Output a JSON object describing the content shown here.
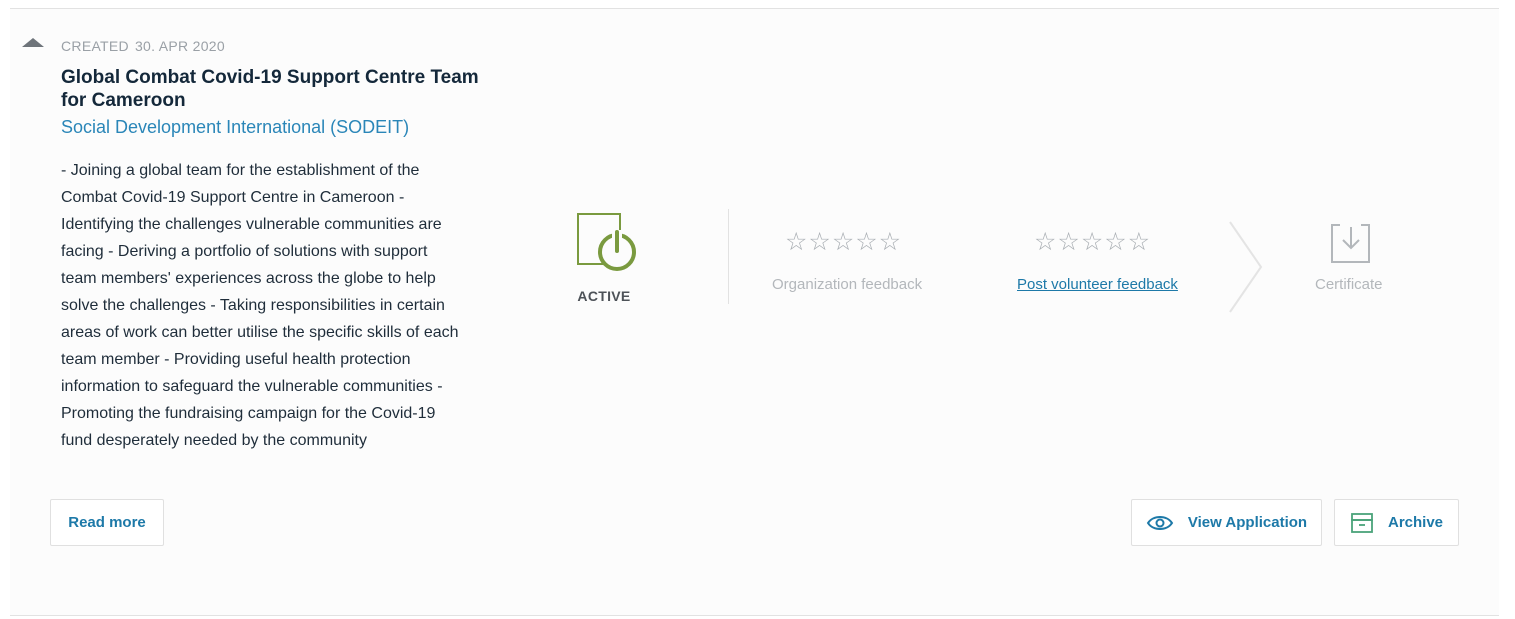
{
  "card": {
    "created_label": "CREATED",
    "created_date": "30. APR 2020",
    "title": "Global Combat Covid-19 Support Centre Team for Cameroon",
    "organization": "Social Development International (SODEIT)",
    "description": "- Joining a global team for the establishment of the Combat Covid-19 Support Centre in Cameroon - Identifying the challenges vulnerable communities are facing - Deriving a portfolio of solutions with support team members' experiences across the globe to help solve the challenges - Taking responsibilities in certain areas of work can better utilise the specific skills of each team member - Providing useful health protection information to safeguard the vulnerable communities - Promoting the fundraising campaign for the Covid-19 fund desperately needed by the community",
    "read_more_label": "Read more"
  },
  "progress": {
    "status_label": "ACTIVE",
    "status_icon": "power-icon",
    "status_color": "#7a9a3f",
    "org_feedback_stars": "☆☆☆☆☆",
    "org_feedback_rating": 0,
    "org_feedback_label": "Organization feedback",
    "volunteer_feedback_stars": "☆☆☆☆☆",
    "volunteer_feedback_rating": 0,
    "volunteer_feedback_label": "Post volunteer feedback",
    "certificate_label": "Certificate",
    "certificate_icon": "download-icon"
  },
  "actions": {
    "view_application_label": "View Application",
    "view_application_icon": "eye-icon",
    "archive_label": "Archive",
    "archive_icon": "archive-box-icon"
  },
  "colors": {
    "accent": "#1d79a8",
    "active_green": "#7a9a3f",
    "muted": "#b3b7bb"
  }
}
